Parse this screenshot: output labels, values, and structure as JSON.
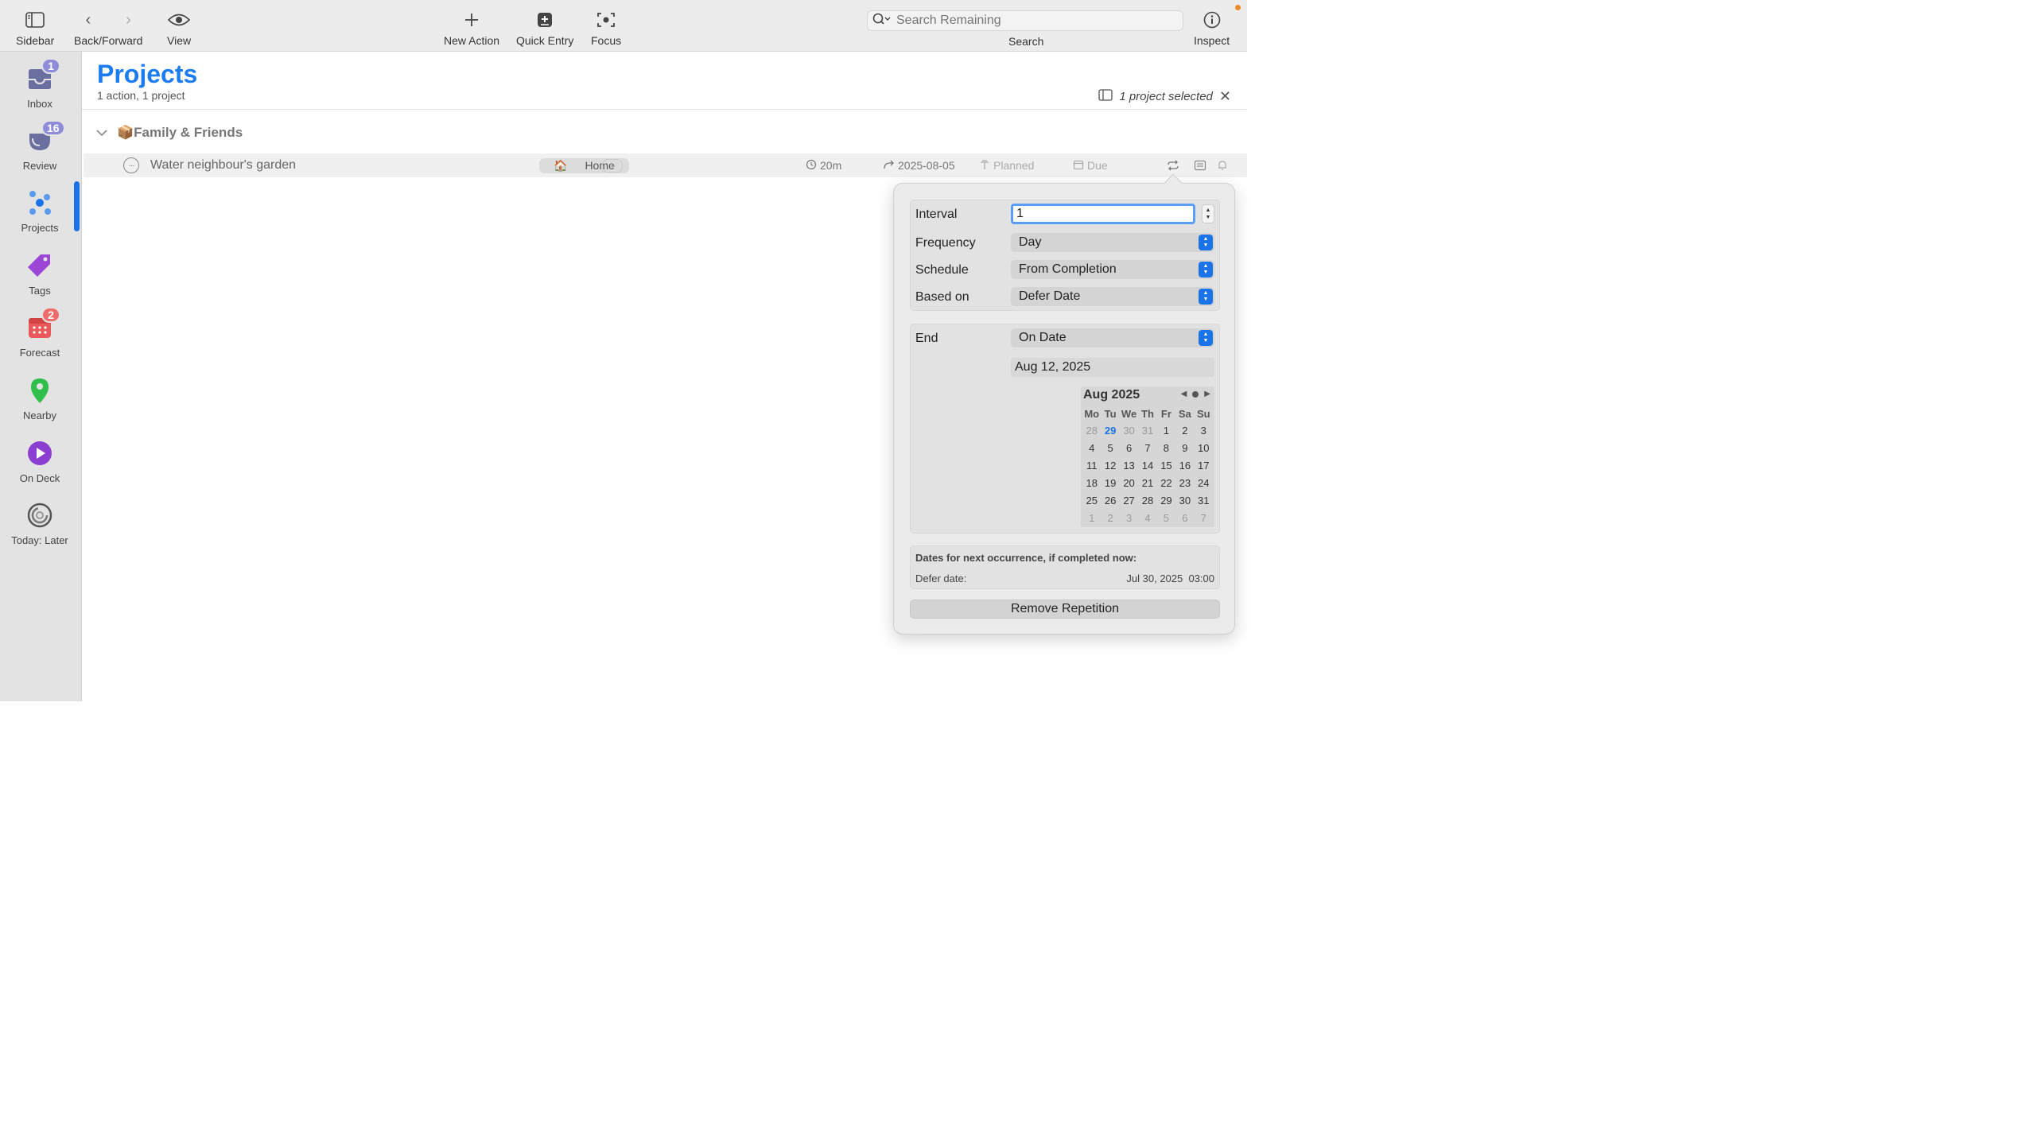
{
  "toolbar": {
    "sidebar": "Sidebar",
    "back_forward": "Back/Forward",
    "view": "View",
    "new_action": "New Action",
    "quick_entry": "Quick Entry",
    "focus": "Focus",
    "search_placeholder": "Search Remaining",
    "search_label": "Search",
    "inspect": "Inspect"
  },
  "sidebar": {
    "items": [
      {
        "label": "Inbox",
        "badge": "1",
        "icon": "inbox-tray-icon",
        "badge_color": "#8e8cd8"
      },
      {
        "label": "Review",
        "badge": "16",
        "icon": "review-cup-icon",
        "badge_color": "#8e8cd8"
      },
      {
        "label": "Projects",
        "icon": "projects-dots-icon"
      },
      {
        "label": "Tags",
        "icon": "tag-icon"
      },
      {
        "label": "Forecast",
        "badge": "2",
        "icon": "calendar-icon",
        "badge_color": "#f06b6b"
      },
      {
        "label": "Nearby",
        "icon": "location-pin-icon"
      },
      {
        "label": "On Deck",
        "icon": "play-circle-icon"
      },
      {
        "label": "Today: Later",
        "icon": "spinner-icon"
      }
    ]
  },
  "main": {
    "title": "Projects",
    "subtitle": "1 action, 1 project",
    "selection": "1 project selected",
    "group": {
      "emoji": "📦",
      "name": "Family & Friends"
    },
    "task": {
      "name": "Water neighbour's garden",
      "tag_emoji": "🏠",
      "tag": "Home",
      "duration": "20m",
      "defer_date": "2025-08-05",
      "planned": "Planned",
      "due": "Due"
    }
  },
  "popover": {
    "interval_label": "Interval",
    "interval_value": "1",
    "frequency_label": "Frequency",
    "frequency_value": "Day",
    "schedule_label": "Schedule",
    "schedule_value": "From Completion",
    "based_on_label": "Based on",
    "based_on_value": "Defer Date",
    "end_label": "End",
    "end_value": "On Date",
    "end_date": "Aug 12, 2025",
    "calendar": {
      "month": "Aug 2025",
      "weekdays": [
        "Mo",
        "Tu",
        "We",
        "Th",
        "Fr",
        "Sa",
        "Su"
      ],
      "days": [
        "28",
        "29",
        "30",
        "31",
        "1",
        "2",
        "3",
        "4",
        "5",
        "6",
        "7",
        "8",
        "9",
        "10",
        "11",
        "12",
        "13",
        "14",
        "15",
        "16",
        "17",
        "18",
        "19",
        "20",
        "21",
        "22",
        "23",
        "24",
        "25",
        "26",
        "27",
        "28",
        "29",
        "30",
        "31",
        "1",
        "2",
        "3",
        "4",
        "5",
        "6",
        "7"
      ]
    },
    "next_title": "Dates for next occurrence, if completed now:",
    "defer_label": "Defer date:",
    "defer_value": "Jul 30, 2025  03:00",
    "remove_button": "Remove Repetition"
  }
}
